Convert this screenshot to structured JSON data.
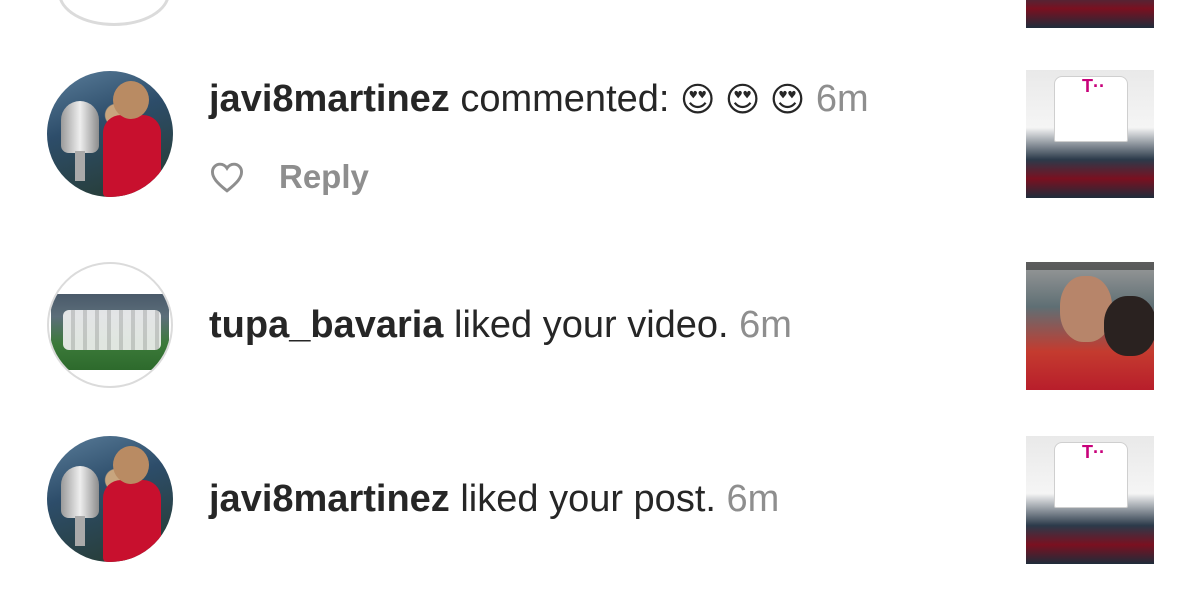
{
  "notifications": [
    {
      "username": "javi8martinez",
      "action": "commented:",
      "emojis": "😍 😍 😍",
      "time": "6m",
      "reply_label": "Reply"
    },
    {
      "username": "tupa_bavaria",
      "action": "liked your video.",
      "time": "6m"
    },
    {
      "username": "javi8martinez",
      "action": "liked your post.",
      "time": "6m"
    }
  ],
  "colors": {
    "username": "#262626",
    "secondary": "#8e8e8e",
    "background": "#ffffff"
  }
}
